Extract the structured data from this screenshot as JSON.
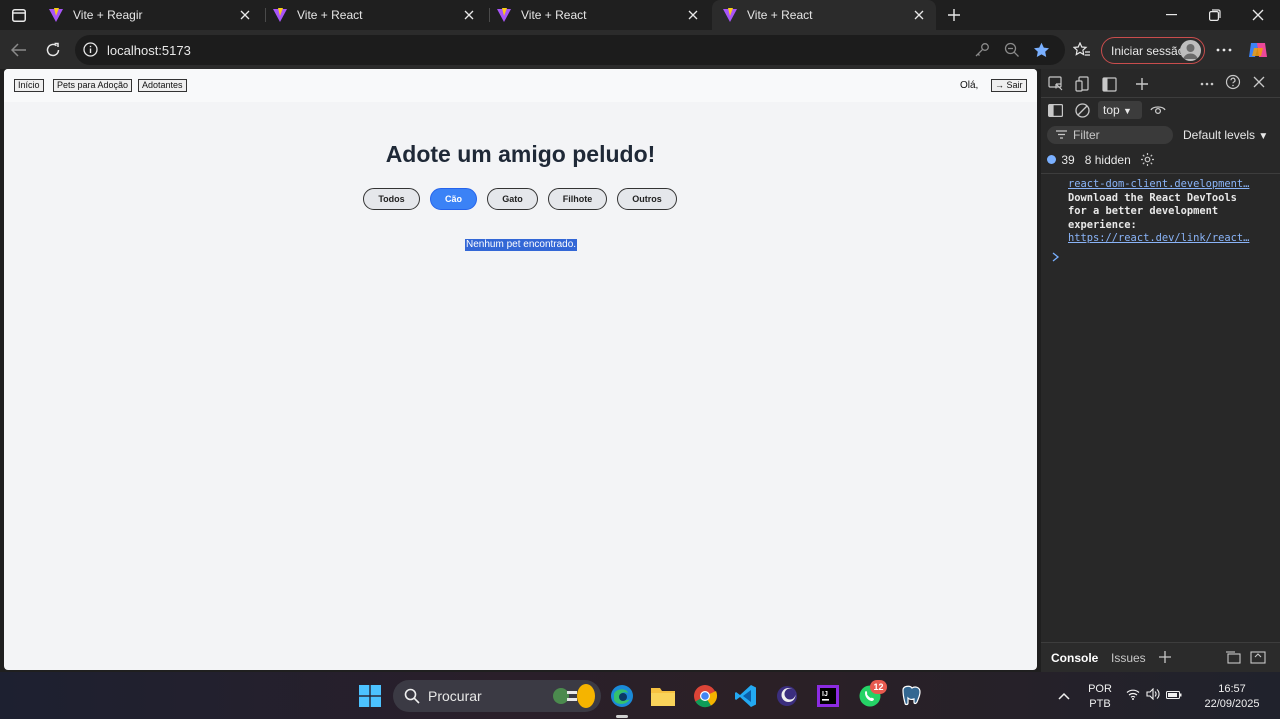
{
  "browser": {
    "tabs": [
      {
        "title": "Vite + Reagir",
        "active": false
      },
      {
        "title": "Vite + React",
        "active": false
      },
      {
        "title": "Vite + React",
        "active": false
      },
      {
        "title": "Vite + React",
        "active": true
      }
    ],
    "url": "localhost:5173",
    "signin_label": "Iniciar sessão"
  },
  "page": {
    "nav": [
      "Início",
      "Pets para Adoção",
      "Adotantes"
    ],
    "greeting": "Olá,",
    "logout_label": "Sair",
    "heading": "Adote um amigo peludo!",
    "filters": [
      {
        "label": "Todos",
        "active": false
      },
      {
        "label": "Cão",
        "active": true
      },
      {
        "label": "Gato",
        "active": false
      },
      {
        "label": "Filhote",
        "active": false
      },
      {
        "label": "Outros",
        "active": false
      }
    ],
    "empty_message": "Nenhum pet encontrado."
  },
  "devtools": {
    "context": "top",
    "filter_placeholder": "Filter",
    "levels": "Default levels",
    "message_count": "39",
    "hidden_count": "8 hidden",
    "log_source": "react-dom-client.development…",
    "log_text": "Download the React DevTools for a better development experience:",
    "log_link": "https://react.dev/link/react…",
    "drawer_tabs": [
      "Console",
      "Issues"
    ]
  },
  "taskbar": {
    "search_placeholder": "Procurar",
    "whatsapp_badge": "12",
    "lang": "POR",
    "layout": "PTB",
    "time": "16:57",
    "date": "22/09/2025"
  }
}
